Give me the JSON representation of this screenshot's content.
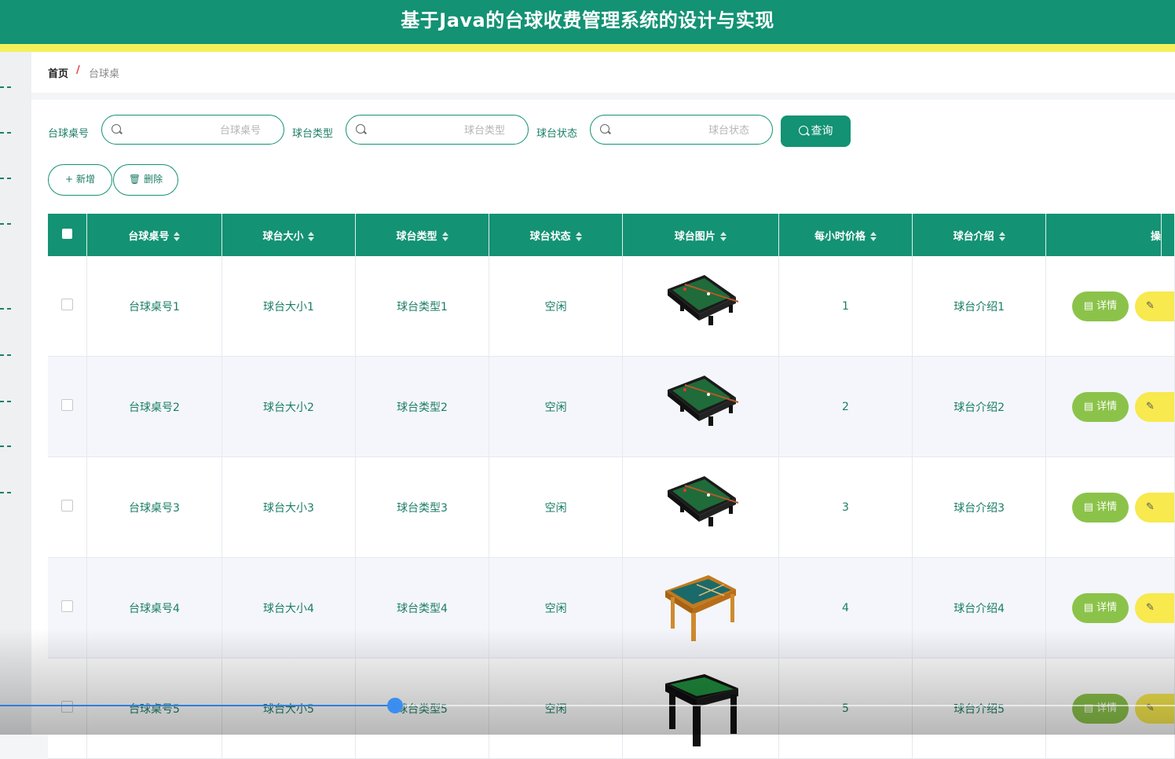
{
  "header": {
    "title": "基于Java的台球收费管理系统的设计与实现"
  },
  "breadcrumb": {
    "home": "首页",
    "separator": "/",
    "current": "台球桌"
  },
  "search": {
    "fields": [
      {
        "label": "台球桌号",
        "placeholder": "台球桌号",
        "value": ""
      },
      {
        "label": "球台类型",
        "placeholder": "球台类型",
        "value": ""
      },
      {
        "label": "球台状态",
        "placeholder": "球台状态",
        "value": ""
      }
    ],
    "query_label": "查询"
  },
  "toolbar": {
    "add_label": "新增",
    "delete_label": "删除"
  },
  "table": {
    "columns": [
      "台球桌号",
      "球台大小",
      "球台类型",
      "球台状态",
      "球台图片",
      "每小时价格",
      "球台介绍",
      "操"
    ],
    "rows": [
      {
        "number": "台球桌号1",
        "size": "球台大小1",
        "type": "球台类型1",
        "status": "空闲",
        "image": "pool-table-dark-green",
        "price": "1",
        "intro": "球台介绍1"
      },
      {
        "number": "台球桌号2",
        "size": "球台大小2",
        "type": "球台类型2",
        "status": "空闲",
        "image": "pool-table-dark-green",
        "price": "2",
        "intro": "球台介绍2"
      },
      {
        "number": "台球桌号3",
        "size": "球台大小3",
        "type": "球台类型3",
        "status": "空闲",
        "image": "pool-table-dark-green",
        "price": "3",
        "intro": "球台介绍3"
      },
      {
        "number": "台球桌号4",
        "size": "球台大小4",
        "type": "球台类型4",
        "status": "空闲",
        "image": "pool-table-wood-teal",
        "price": "4",
        "intro": "球台介绍4"
      },
      {
        "number": "台球桌号5",
        "size": "球台大小5",
        "type": "球台类型5",
        "status": "空闲",
        "image": "pool-table-black-legs",
        "price": "5",
        "intro": "球台介绍5"
      }
    ],
    "detail_label": "详情"
  },
  "video": {
    "progress": 0.336
  },
  "colors": {
    "primary": "#139274",
    "accent_yellow": "#f5f05a",
    "detail_green": "#8bc34a",
    "edit_yellow": "#f7e94e"
  }
}
